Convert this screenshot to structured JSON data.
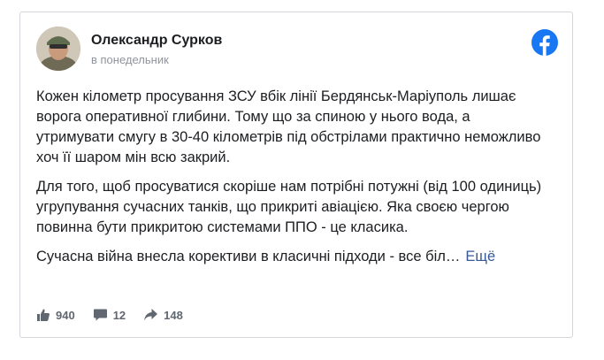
{
  "post": {
    "author": "Олександр Сурков",
    "date": "в понедельник",
    "paragraphs": [
      "Кожен кілометр просування ЗСУ вбік лінії Бердянськ-Маріуполь лишає ворога оперативної глибини. Тому що за спиною у нього вода, а утримувати смугу в 30-40 кілометрів під обстрілами практично неможливо хоч її шаром мін всю закрий.",
      "Для того, щоб просуватися скоріше нам потрібні потужні (від 100 одиниць) угрупування сучасних танків, що прикриті авіацією. Яка своєю чергою повинна бути прикритою системами ППО - це класика."
    ],
    "truncated_text": "Сучасна війна внесла корективи в класичні підходи - все біл…",
    "more_label": "Ещё"
  },
  "stats": {
    "likes": "940",
    "comments": "12",
    "shares": "148"
  },
  "icons": {
    "brand": "facebook-icon",
    "like": "thumbs-up-icon",
    "comment": "comment-icon",
    "share": "share-icon"
  },
  "colors": {
    "facebook_blue": "#1877f2",
    "link": "#385898",
    "muted": "#90949c"
  }
}
